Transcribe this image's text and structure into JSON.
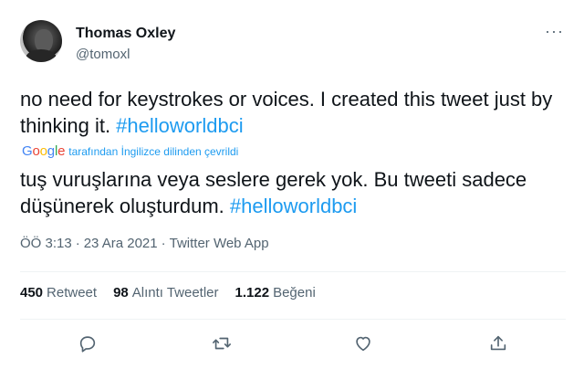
{
  "author": {
    "name": "Thomas Oxley",
    "handle": "@tomoxl"
  },
  "more_icon": "more-horizontal-icon",
  "tweet": {
    "text_before": "no need for keystrokes or voices. I created this tweet just by thinking it. ",
    "hashtag": "#helloworldbci",
    "translation_note": "tarafından İngilizce dilinden çevrildi",
    "translation_logo": "Google",
    "translated_before": "tuş vuruşlarına veya seslere gerek yok. Bu tweeti sadece düşünerek oluşturdum. ",
    "translated_hashtag": "#helloworldbci"
  },
  "meta": {
    "time": "ÖÖ 3:13",
    "sep1": "·",
    "date": "23 Ara 2021",
    "sep2": "·",
    "source": "Twitter Web App"
  },
  "stats": {
    "retweets": {
      "value": "450",
      "label": "Retweet"
    },
    "quotes": {
      "value": "98",
      "label": "Alıntı Tweetler"
    },
    "likes": {
      "value": "1.122",
      "label": "Beğeni"
    }
  },
  "actions": [
    "reply-icon",
    "retweet-icon",
    "like-icon",
    "share-icon"
  ],
  "colors": {
    "accent": "#1d9bf0",
    "secondary_text": "#536471",
    "text": "#0f1419"
  }
}
